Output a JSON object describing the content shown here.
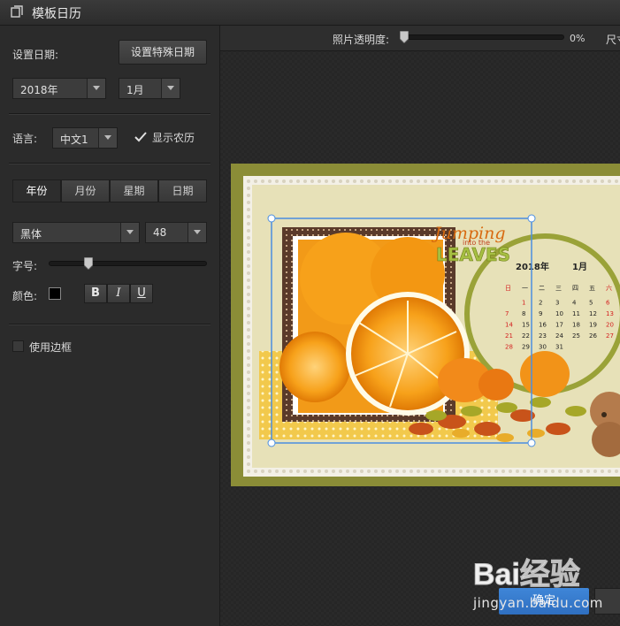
{
  "window": {
    "title": "模板日历"
  },
  "left": {
    "date_label": "设置日期:",
    "special_date_button": "设置特殊日期",
    "year_select": "2018年",
    "month_select": "1月",
    "language_label": "语言:",
    "language_select": "中文1",
    "show_lunar_label": "显示农历",
    "show_lunar_checked": true,
    "tabs": [
      {
        "label": "年份",
        "active": true
      },
      {
        "label": "月份",
        "active": false
      },
      {
        "label": "星期",
        "active": false
      },
      {
        "label": "日期",
        "active": false
      }
    ],
    "font_select": "黑体",
    "font_size_select": "48",
    "size_label": "字号:",
    "size_slider_fraction": 0.25,
    "color_label": "颜色:",
    "color_value": "#000000",
    "format_buttons": [
      "B",
      "I",
      "U"
    ],
    "border_label": "使用边框",
    "border_checked": false
  },
  "toolbar": {
    "opacity_label": "照片透明度:",
    "opacity_value": "0%",
    "size_label_partial": "尺寸"
  },
  "calendar": {
    "year": "2018年",
    "month": "1月",
    "title_art": [
      "Jumping",
      "into the",
      "LEAVES"
    ],
    "weekdays": [
      "日",
      "一",
      "二",
      "三",
      "四",
      "五",
      "六"
    ],
    "weeks": [
      [
        "",
        "1",
        "2",
        "3",
        "4",
        "5",
        "6"
      ],
      [
        "7",
        "8",
        "9",
        "10",
        "11",
        "12",
        "13"
      ],
      [
        "14",
        "15",
        "16",
        "17",
        "18",
        "19",
        "20"
      ],
      [
        "21",
        "22",
        "23",
        "24",
        "25",
        "26",
        "27"
      ],
      [
        "28",
        "29",
        "30",
        "31",
        "",
        "",
        ""
      ]
    ]
  },
  "footer": {
    "confirm_button": "确定",
    "watermark_text": "Bai经验",
    "watermark_url": "jingyan.baidu.com"
  },
  "colors": {
    "accent_blue": "#3f86d8",
    "calendar_red": "#d42020",
    "orange": "#f08a10",
    "frame_olive": "#8a8c3a"
  }
}
